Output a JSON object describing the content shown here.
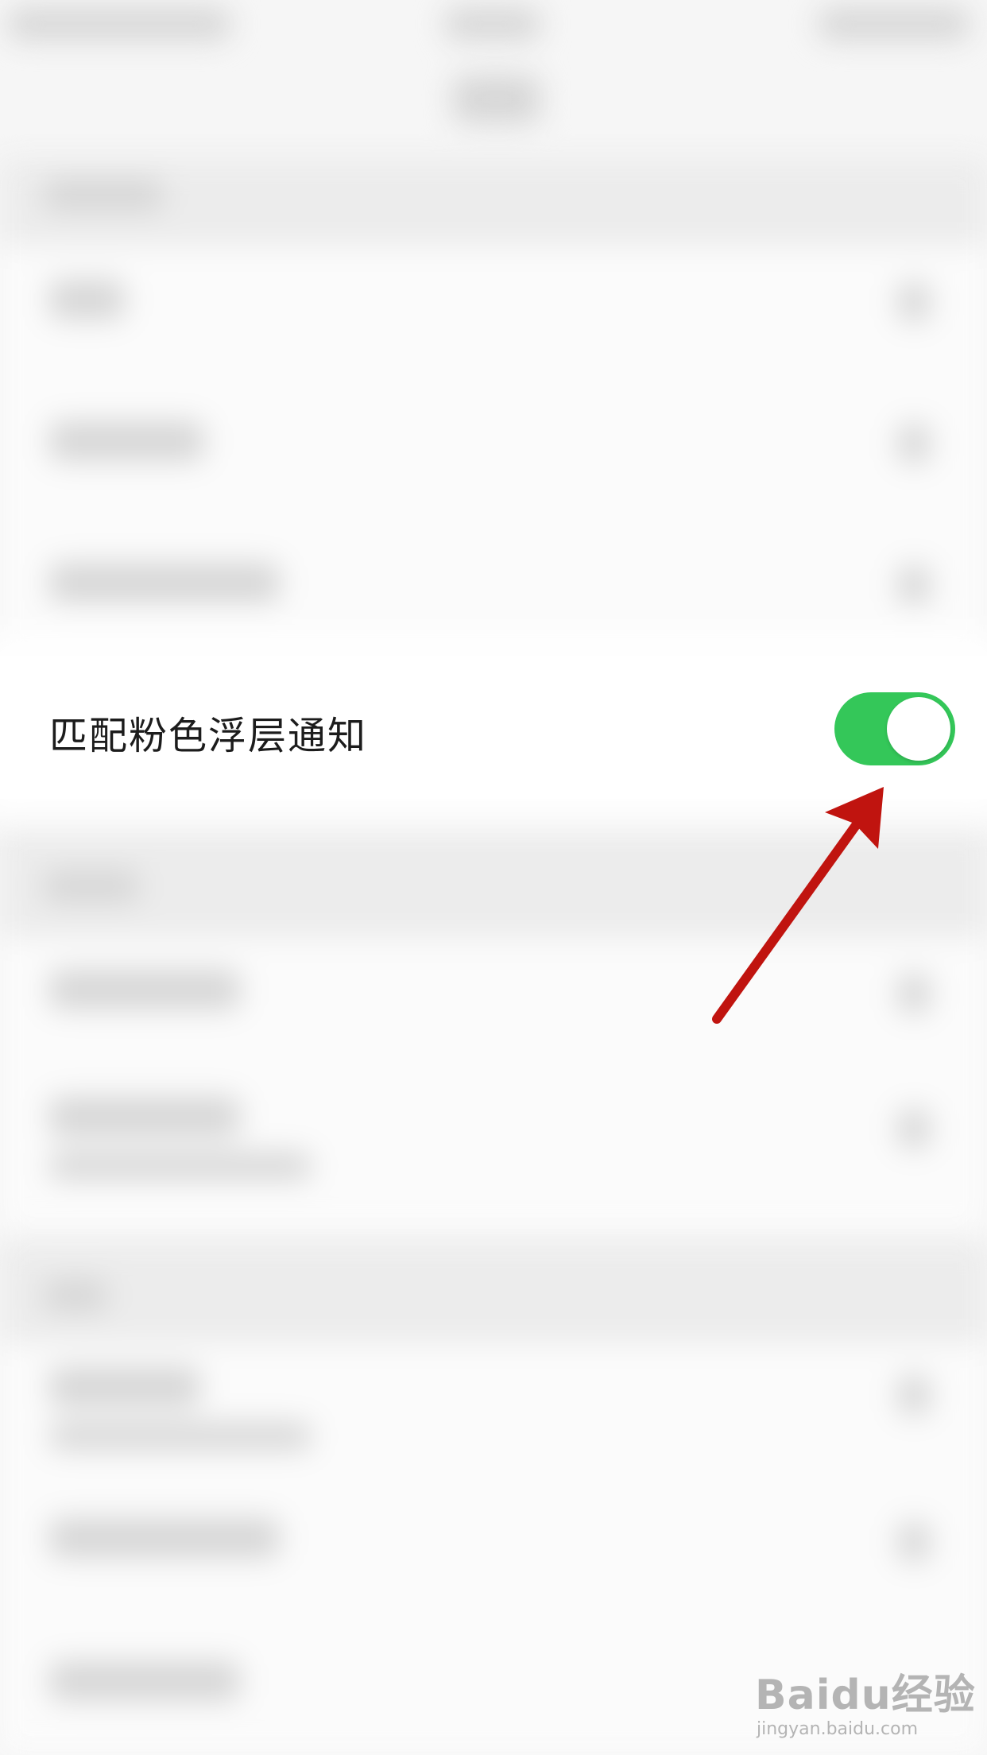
{
  "setting": {
    "label": "匹配粉色浮层通知",
    "toggle_on": true
  },
  "colors": {
    "toggle_on": "#34c759",
    "annotation_arrow": "#c0140f",
    "background": "#f6f6f6"
  },
  "icons": {
    "annotation": "red-arrow-icon"
  },
  "watermark": {
    "logo": "Baidu经验",
    "url": "jingyan.baidu.com"
  }
}
